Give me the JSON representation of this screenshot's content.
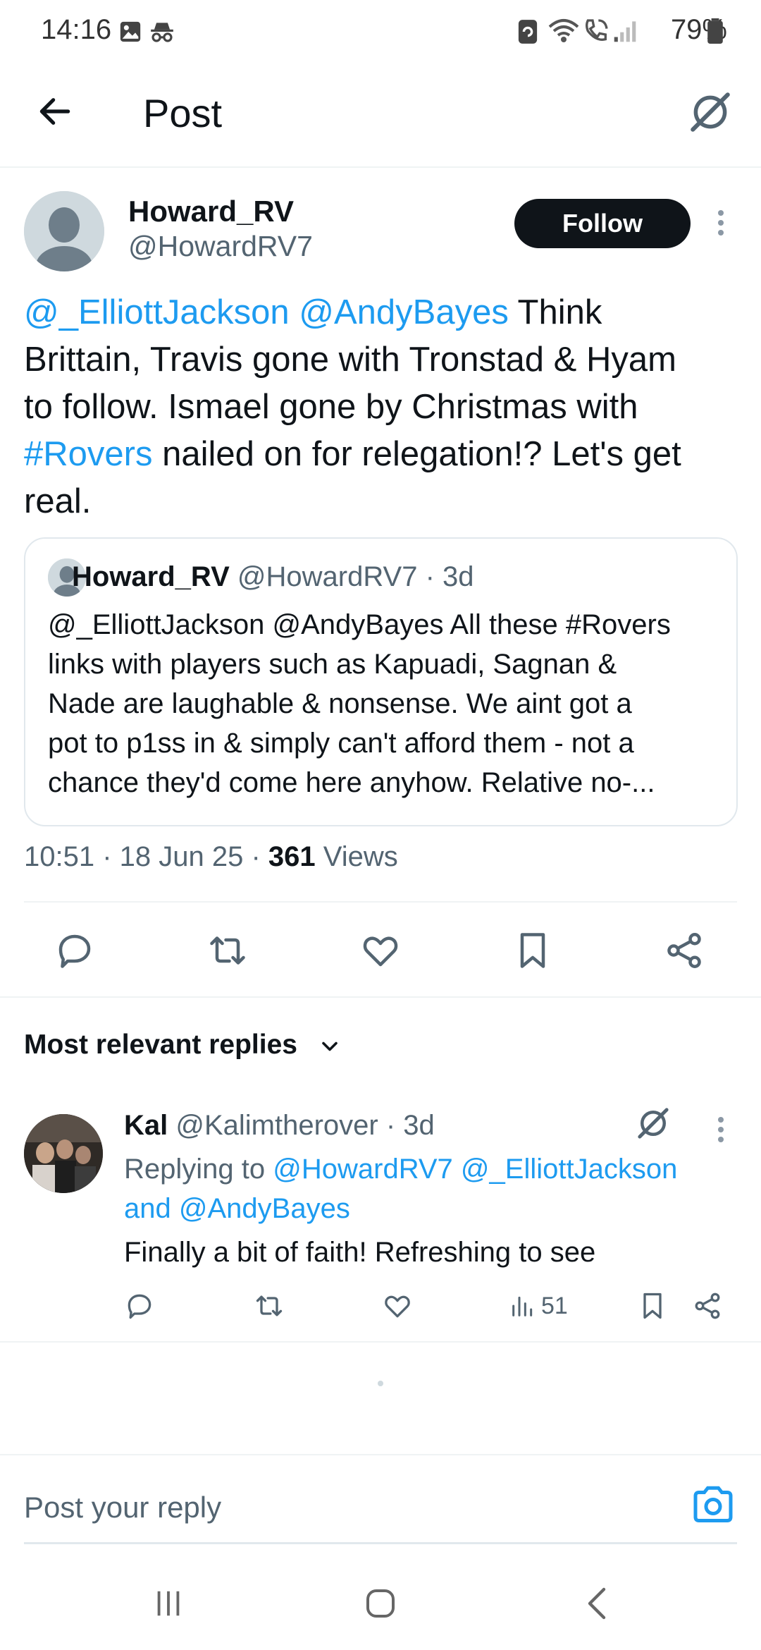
{
  "status_bar": {
    "time": "14:16",
    "battery": "79%"
  },
  "header": {
    "title": "Post"
  },
  "post": {
    "author_name": "Howard_RV",
    "author_handle": "@HowardRV7",
    "follow_label": "Follow",
    "text_parts": {
      "mention1": "@_ElliottJackson",
      "mention2": "@AndyBayes",
      "line1_rest": " Think",
      "line2": "Brittain, Travis gone with Tronstad & Hyam",
      "line3": "to follow.  Ismael gone by Christmas with",
      "hashtag": "#Rovers",
      "line4_rest": " nailed on for relegation!?  Let's get",
      "line5": "real."
    },
    "quoted": {
      "author_name": "Howard_RV",
      "author_handle": "@HowardRV7",
      "age": "· 3d",
      "lines": [
        "@_ElliottJackson @AndyBayes All these #Rovers",
        "links with players such as Kapuadi, Sagnan &",
        "Nade are laughable & nonsense.  We aint got a",
        "pot to p1ss in & simply can't afford them - not a",
        "chance they'd come here anyhow.  Relative no-..."
      ]
    },
    "meta": {
      "time": "10:51",
      "date": "18 Jun 25",
      "views_count": "361",
      "views_label": "Views"
    }
  },
  "replies_heading": "Most relevant replies",
  "reply": {
    "author_name": "Kal",
    "author_handle": "@Kalimtherover",
    "age": "· 3d",
    "replying_to_label": "Replying to",
    "replying_to_1": "@HowardRV7",
    "replying_to_2": "@_ElliottJackson",
    "replying_and": "and",
    "replying_to_3": "@AndyBayes",
    "text": "Finally a bit of faith! Refreshing to see",
    "views": "51"
  },
  "reply_input": {
    "placeholder": "Post your reply"
  },
  "colors": {
    "accent": "#1d9bf0",
    "text": "#0f1419",
    "muted": "#536471",
    "divider": "#eff3f4"
  },
  "icons": [
    "back-arrow-icon",
    "grok-icon",
    "reply-icon",
    "retweet-icon",
    "like-icon",
    "bookmark-icon",
    "share-icon",
    "chevron-down-icon",
    "views-icon",
    "camera-icon"
  ]
}
